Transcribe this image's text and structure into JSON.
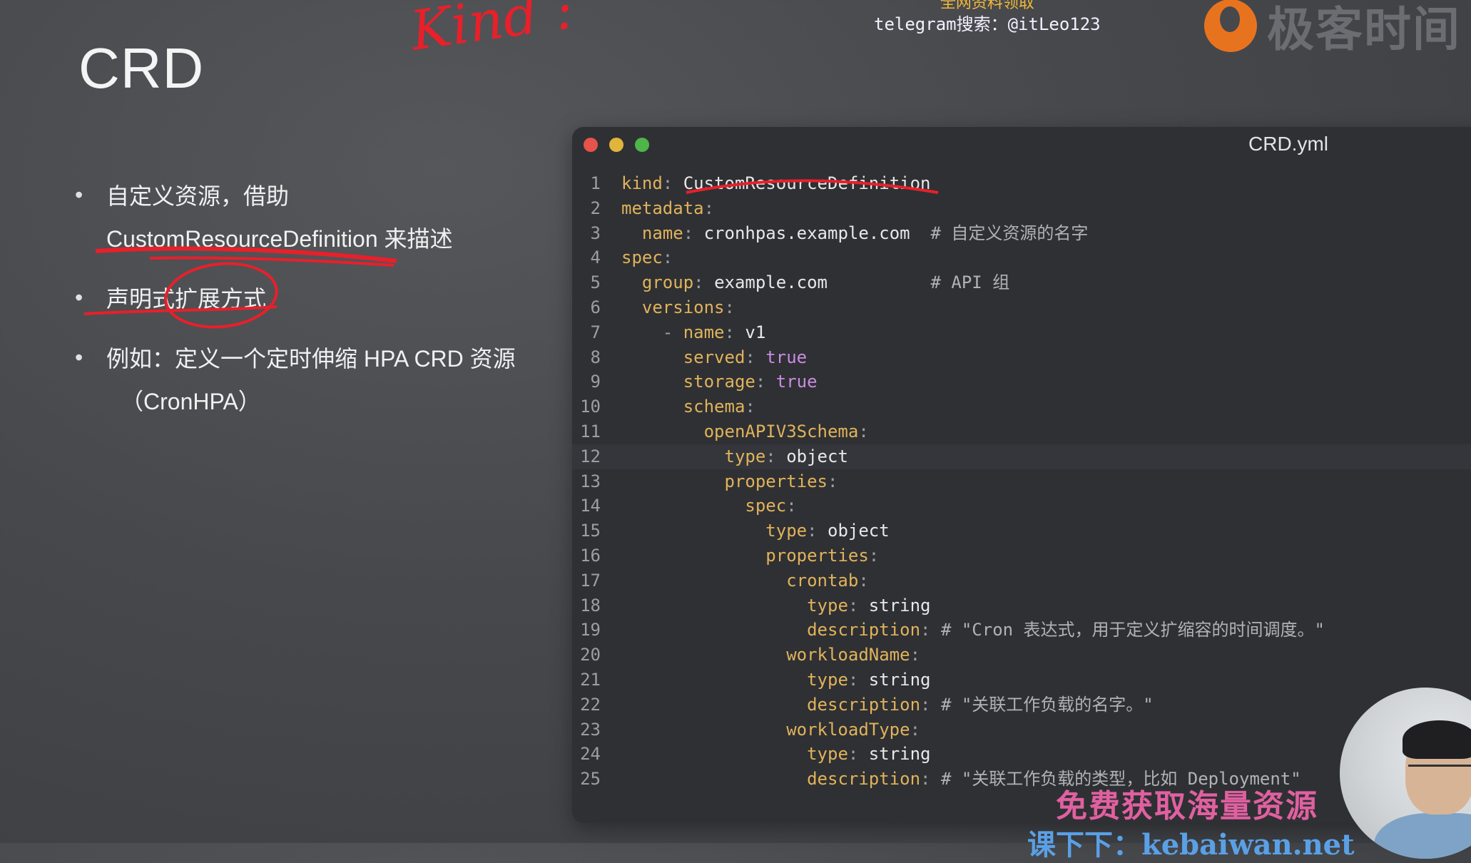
{
  "slide": {
    "title": "CRD",
    "bullets": [
      {
        "line1": "自定义资源，借助",
        "line2_a": "CustomResourceDefinition",
        "line2_b": " 来描述"
      },
      {
        "line1": "声明式扩展方式"
      },
      {
        "line1": "例如：定义一个定时伸缩 HPA CRD 资源",
        "line2": "（CronHPA）"
      }
    ]
  },
  "watermarks": {
    "top_partial": "全网资料领取",
    "telegram": "telegram搜索：@itLeo123",
    "brand": "极客时间",
    "bottom1": "免费获取海量资源",
    "bottom2": "课下下：kebaiwan.net"
  },
  "annotation": {
    "handwritten": "Kind :"
  },
  "editor": {
    "filename": "CRD.yml",
    "highlighted_line": 12,
    "lines": [
      {
        "n": "1",
        "indent": "",
        "key": "kind",
        "val": "CustomResourceDefinition"
      },
      {
        "n": "2",
        "indent": "",
        "key": "metadata",
        "val": ""
      },
      {
        "n": "3",
        "indent": "  ",
        "key": "name",
        "val": "cronhpas.example.com",
        "comment": "  # 自定义资源的名字"
      },
      {
        "n": "4",
        "indent": "",
        "key": "spec",
        "val": ""
      },
      {
        "n": "5",
        "indent": "  ",
        "key": "group",
        "val": "example.com",
        "comment": "          # API 组"
      },
      {
        "n": "6",
        "indent": "  ",
        "key": "versions",
        "val": ""
      },
      {
        "n": "7",
        "indent": "    - ",
        "key": "name",
        "val": "v1"
      },
      {
        "n": "8",
        "indent": "      ",
        "key": "served",
        "bool": "true"
      },
      {
        "n": "9",
        "indent": "      ",
        "key": "storage",
        "bool": "true"
      },
      {
        "n": "10",
        "indent": "      ",
        "key": "schema",
        "val": ""
      },
      {
        "n": "11",
        "indent": "        ",
        "key": "openAPIV3Schema",
        "val": ""
      },
      {
        "n": "12",
        "indent": "          ",
        "key": "type",
        "val": "object"
      },
      {
        "n": "13",
        "indent": "          ",
        "key": "properties",
        "val": ""
      },
      {
        "n": "14",
        "indent": "            ",
        "key": "spec",
        "val": ""
      },
      {
        "n": "15",
        "indent": "              ",
        "key": "type",
        "val": "object"
      },
      {
        "n": "16",
        "indent": "              ",
        "key": "properties",
        "val": ""
      },
      {
        "n": "17",
        "indent": "                ",
        "key": "crontab",
        "val": ""
      },
      {
        "n": "18",
        "indent": "                  ",
        "key": "type",
        "val": "string"
      },
      {
        "n": "19",
        "indent": "                  ",
        "key": "description",
        "val": "",
        "comment": " # \"Cron 表达式，用于定义扩缩容的时间调度。\""
      },
      {
        "n": "20",
        "indent": "                ",
        "key": "workloadName",
        "val": ""
      },
      {
        "n": "21",
        "indent": "                  ",
        "key": "type",
        "val": "string"
      },
      {
        "n": "22",
        "indent": "                  ",
        "key": "description",
        "val": "",
        "comment": " # \"关联工作负载的名字。\""
      },
      {
        "n": "23",
        "indent": "                ",
        "key": "workloadType",
        "val": ""
      },
      {
        "n": "24",
        "indent": "                  ",
        "key": "type",
        "val": "string"
      },
      {
        "n": "25",
        "indent": "                  ",
        "key": "description",
        "val": "",
        "comment": " # \"关联工作负载的类型，比如 Deployment\""
      }
    ]
  },
  "colors": {
    "key": "#e0b35a",
    "bool": "#c88ce0",
    "annotation": "#e8202a"
  }
}
